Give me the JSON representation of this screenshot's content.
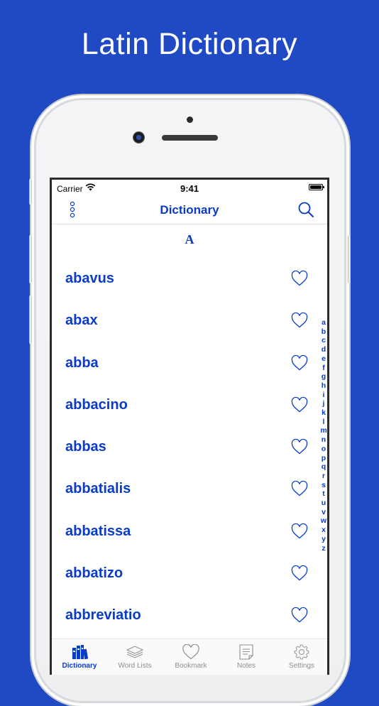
{
  "promo": {
    "title": "Latin Dictionary"
  },
  "colors": {
    "background": "#1f4ac4",
    "accent": "#0a3bc9",
    "inactive": "#8e8e93"
  },
  "status_bar": {
    "carrier": "Carrier",
    "time": "9:41",
    "wifi_icon": "wifi-icon",
    "battery_icon": "battery-icon"
  },
  "nav_bar": {
    "title": "Dictionary",
    "left_icon": "more-vertical-icon",
    "right_icon": "search-icon"
  },
  "section": {
    "header": "A"
  },
  "words": [
    {
      "word": "abavus",
      "bookmarked": false
    },
    {
      "word": "abax",
      "bookmarked": false
    },
    {
      "word": "abba",
      "bookmarked": false
    },
    {
      "word": "abbacino",
      "bookmarked": false
    },
    {
      "word": "abbas",
      "bookmarked": false
    },
    {
      "word": "abbatialis",
      "bookmarked": false
    },
    {
      "word": "abbatissa",
      "bookmarked": false
    },
    {
      "word": "abbatizo",
      "bookmarked": false
    },
    {
      "word": "abbreviatio",
      "bookmarked": false
    }
  ],
  "alphabet_index": [
    "a",
    "b",
    "c",
    "d",
    "e",
    "f",
    "g",
    "h",
    "i",
    "j",
    "k",
    "l",
    "m",
    "n",
    "o",
    "p",
    "q",
    "r",
    "s",
    "t",
    "u",
    "v",
    "w",
    "x",
    "y",
    "z"
  ],
  "tabs": [
    {
      "label": "Dictionary",
      "icon": "books-icon",
      "active": true
    },
    {
      "label": "Word Lists",
      "icon": "stack-icon",
      "active": false
    },
    {
      "label": "Bookmark",
      "icon": "heart-icon",
      "active": false
    },
    {
      "label": "Notes",
      "icon": "note-icon",
      "active": false
    },
    {
      "label": "Settings",
      "icon": "gear-icon",
      "active": false
    }
  ]
}
